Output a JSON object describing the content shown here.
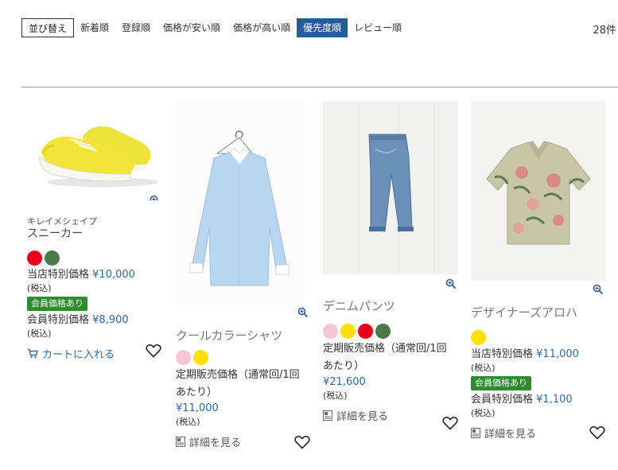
{
  "sort": {
    "label": "並び替え",
    "options": [
      "新着順",
      "登録順",
      "価格が安い順",
      "価格が高い順",
      "優先度順",
      "レビュー順"
    ],
    "active_index": 4
  },
  "result_count": "28件",
  "products": [
    {
      "brand": "キレイメシェイプ",
      "name": "スニーカー",
      "swatches": [
        "#e8001a",
        "#4a7a4a"
      ],
      "price_label": "当店特別価格",
      "price": "¥10,000",
      "tax": "(税込)",
      "member_badge": "会員価格あり",
      "member_label": "会員特別価格",
      "member_price": "¥8,900",
      "member_tax": "(税込)",
      "action": "カートに入れる"
    },
    {
      "name": "クールカラーシャツ",
      "swatches": [
        "#f6c6d6",
        "#ffe000"
      ],
      "price_label": "定期販売価格（通常回/1回あたり）",
      "price": "¥11,000",
      "tax": "(税込)",
      "action": "詳細を見る"
    },
    {
      "name": "デニムパンツ",
      "swatches": [
        "#f6c6d6",
        "#ffe000",
        "#e8001a",
        "#4a7a4a"
      ],
      "price_label": "定期販売価格（通常回/1回あたり）",
      "price": "¥21,600",
      "tax": "(税込)",
      "action": "詳細を見る"
    },
    {
      "name": "デザイナーズアロハ",
      "swatches": [
        "#ffe000"
      ],
      "price_label": "当店特別価格",
      "price": "¥11,000",
      "tax": "(税込)",
      "member_badge": "会員価格あり",
      "member_label": "会員特別価格",
      "member_price": "¥1,100",
      "member_tax": "(税込)",
      "action": "詳細を見る"
    }
  ],
  "colors": {
    "accent": "#2a5a9a",
    "price": "#2a6aae",
    "badge": "#2e8b2e"
  }
}
